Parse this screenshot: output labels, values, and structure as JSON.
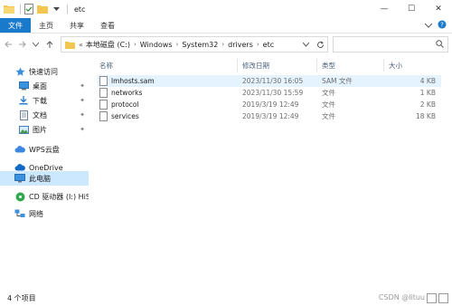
{
  "window": {
    "title": "etc",
    "controls": {
      "minimize": "—",
      "maximize": "☐",
      "close": "✕"
    }
  },
  "ribbon": {
    "tabs": [
      "文件",
      "主页",
      "共享",
      "查看"
    ]
  },
  "address": {
    "overflow": "«",
    "crumbs": [
      "本地磁盘 (C:)",
      "Windows",
      "System32",
      "drivers",
      "etc"
    ],
    "search_placeholder": ""
  },
  "nav": {
    "items": [
      {
        "label": "快速访问",
        "icon": "star-icon"
      },
      {
        "label": "桌面",
        "icon": "desktop-icon",
        "pinned": true
      },
      {
        "label": "下载",
        "icon": "download-icon",
        "pinned": true
      },
      {
        "label": "文档",
        "icon": "document-icon",
        "pinned": true
      },
      {
        "label": "图片",
        "icon": "picture-icon",
        "pinned": true
      },
      {
        "label": "WPS云盘",
        "icon": "cloud-icon"
      },
      {
        "label": "OneDrive",
        "icon": "onedrive-icon"
      },
      {
        "label": "此电脑",
        "icon": "computer-icon",
        "selected": true
      },
      {
        "label": "CD 驱动器 (I:) HiSuite",
        "icon": "cd-drive-icon"
      },
      {
        "label": "网络",
        "icon": "network-icon"
      }
    ]
  },
  "list": {
    "columns": [
      "名称",
      "修改日期",
      "类型",
      "大小"
    ],
    "rows": [
      {
        "name": "lmhosts.sam",
        "date": "2023/11/30 16:05",
        "type": "SAM 文件",
        "size": "4 KB"
      },
      {
        "name": "networks",
        "date": "2023/11/30 15:59",
        "type": "文件",
        "size": "1 KB"
      },
      {
        "name": "protocol",
        "date": "2019/3/19 12:49",
        "type": "文件",
        "size": "2 KB"
      },
      {
        "name": "services",
        "date": "2019/3/19 12:49",
        "type": "文件",
        "size": "18 KB"
      }
    ]
  },
  "status": {
    "item_count": "4 个项目",
    "watermark": "CSDN @lituu"
  },
  "colors": {
    "accent": "#1979ca",
    "selected_bg": "#cce8ff",
    "hover_bg": "#e5f3ff",
    "folder": "#f3c74f"
  }
}
